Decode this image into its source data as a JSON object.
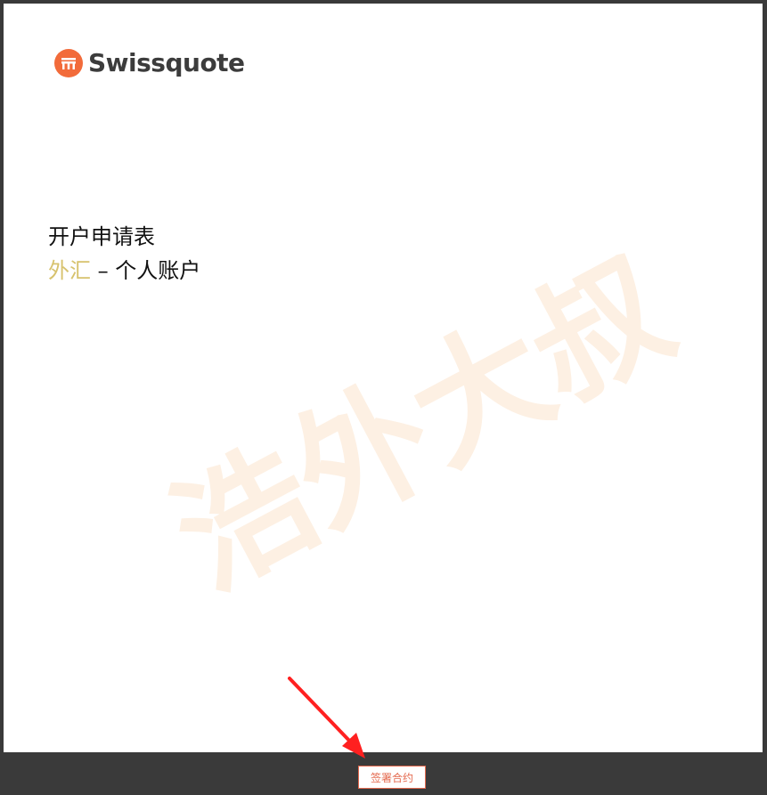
{
  "logo": {
    "text": "Swissquote",
    "icon": "swissquote-logo-icon",
    "brand_color": "#f26b3a"
  },
  "document": {
    "title": "开户申请表",
    "subtitle_accent": "外汇",
    "subtitle_rest": " – 个人账户",
    "accent_color": "#d7c26d"
  },
  "watermark": {
    "text": "浩外大叔"
  },
  "footer": {
    "sign_button_label": "签署合约"
  },
  "annotation": {
    "arrow_color": "#ff2020",
    "icon": "red-arrow-icon"
  }
}
